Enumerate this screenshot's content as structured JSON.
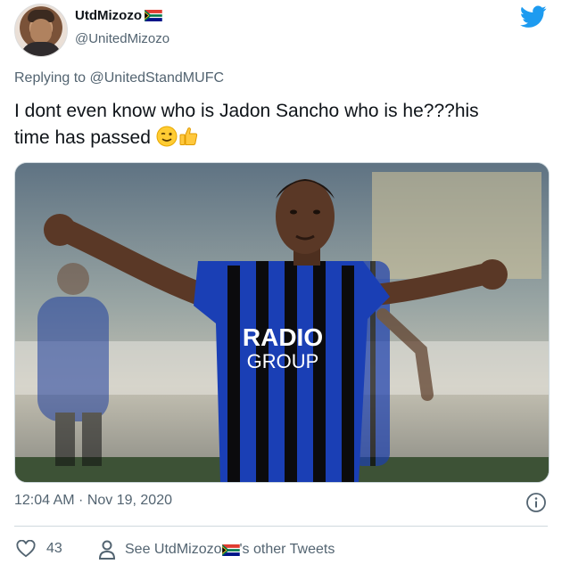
{
  "author": {
    "display_name": "UtdMizozo",
    "handle": "@UnitedMizozo"
  },
  "reply": {
    "prefix": "Replying to ",
    "mention": "@UnitedStandMUFC"
  },
  "tweet": {
    "line1": "I dont even know who is Jadon Sancho who is he???his",
    "line2": "time has passed"
  },
  "media": {
    "jersey_text_1": "RADIO",
    "jersey_text_2": "GROUP",
    "jersey_colors": [
      "#1a3fb5",
      "#0b0b0d"
    ]
  },
  "meta": {
    "timestamp": "12:04 AM · Nov 19, 2020"
  },
  "actions": {
    "like_count": "43",
    "see_prefix": "See UtdMizozo",
    "see_suffix": "'s other Tweets"
  },
  "icons": {
    "brand": "twitter-bird-icon",
    "info": "info-icon",
    "heart": "heart-icon",
    "person": "person-icon"
  },
  "colors": {
    "twitter_blue": "#1d9bf0",
    "secondary_text": "#536471"
  }
}
